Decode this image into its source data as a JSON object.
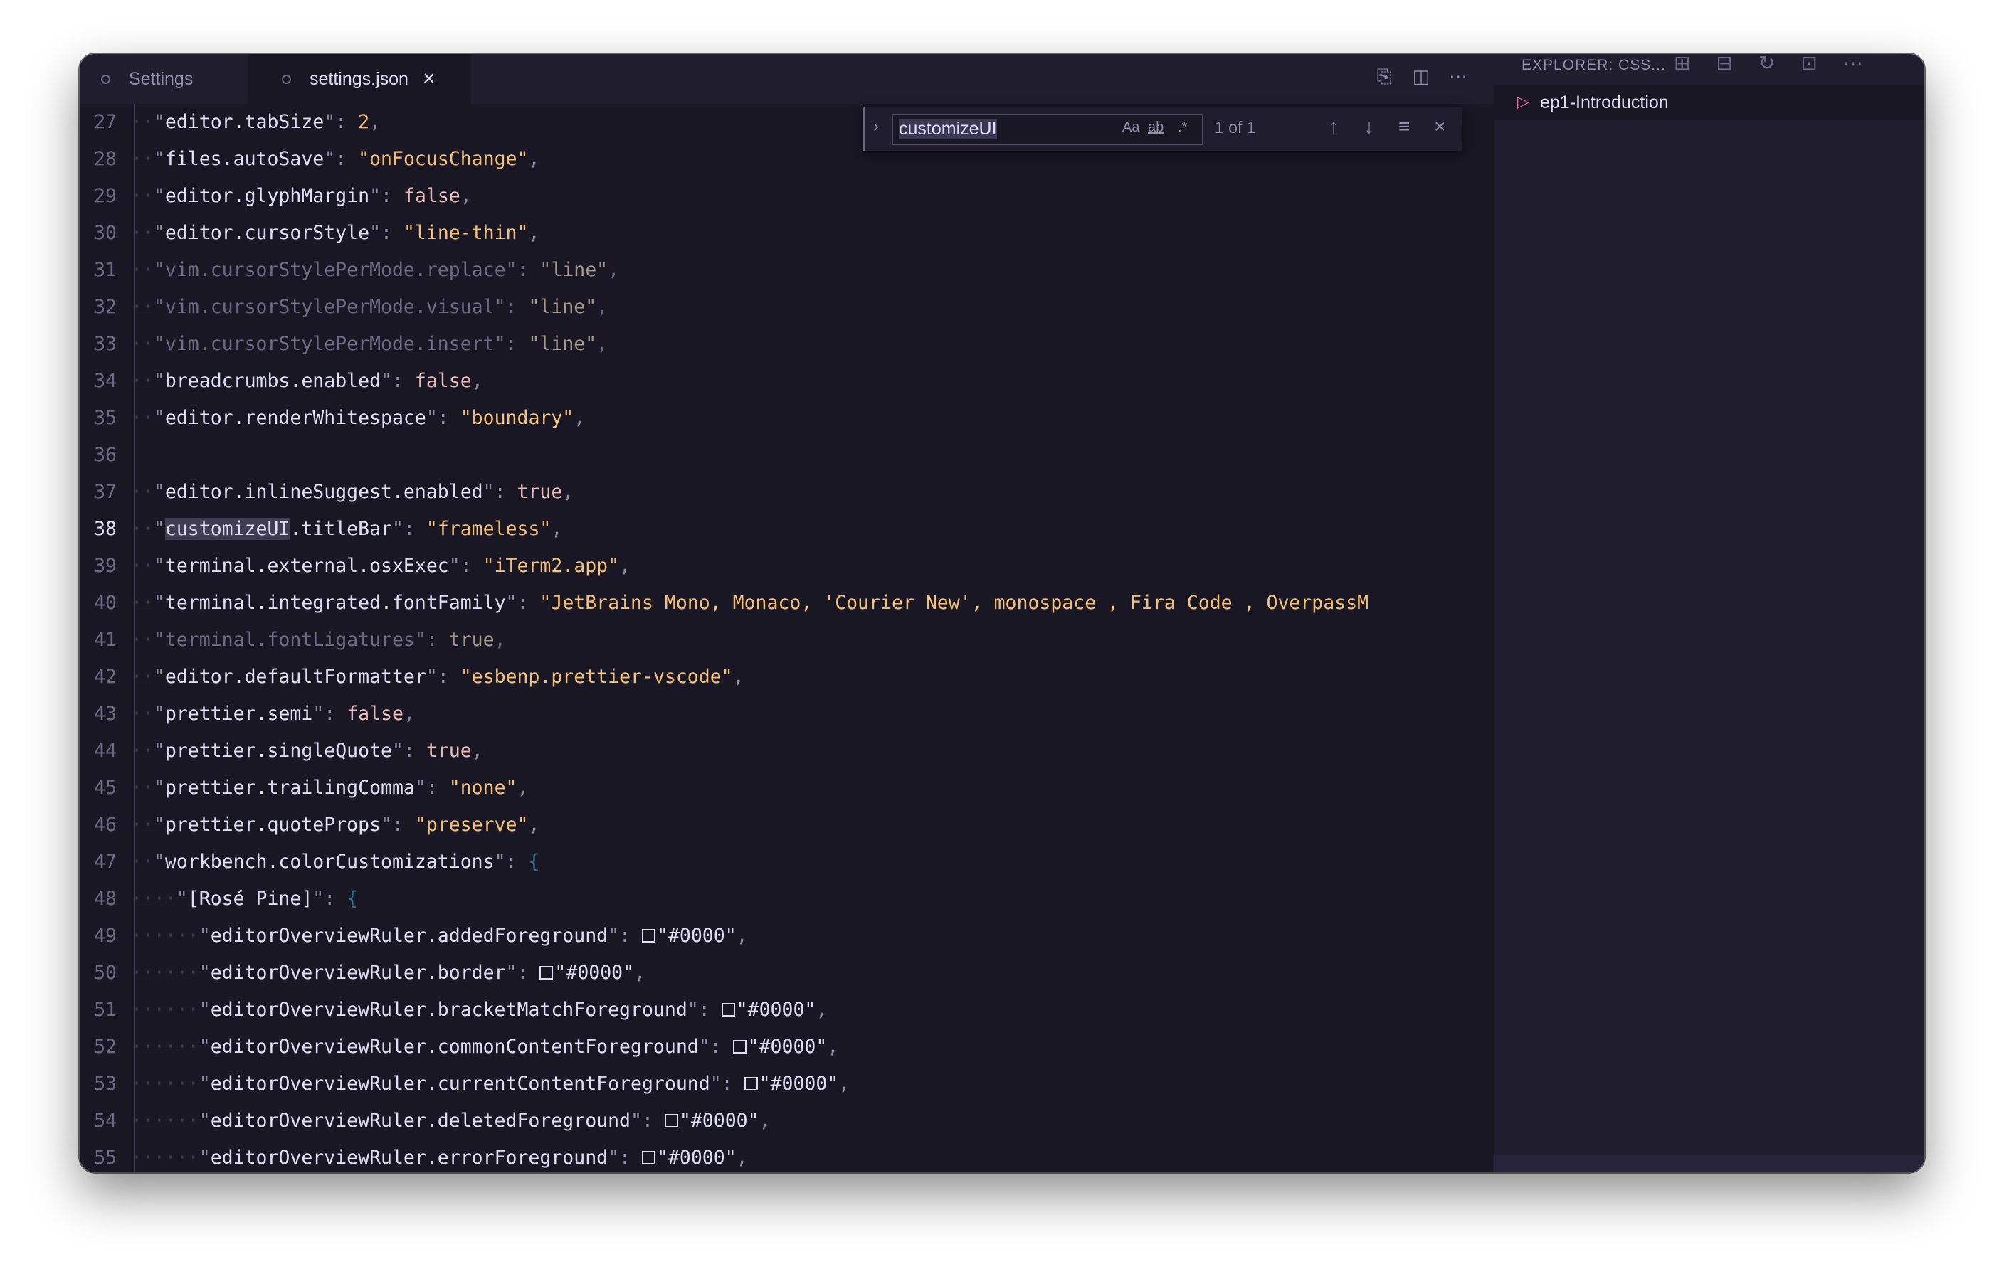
{
  "tabs": [
    {
      "label": "Settings",
      "active": false
    },
    {
      "label": "settings.json",
      "active": true
    }
  ],
  "tab_close_symbol": "×",
  "icons": {
    "open_preview": "open-file-icon",
    "split": "split-editor-icon",
    "more": "more-actions-icon"
  },
  "find": {
    "query": "customizeUI",
    "match_case": "Aa",
    "whole_word": "ab",
    "regex": ".*",
    "count": "1 of 1"
  },
  "explorer": {
    "title": "EXPLORER: CSS...",
    "items": [
      {
        "label": "ep1-Introduction"
      }
    ]
  },
  "editor": {
    "current_line": 38,
    "lines": [
      {
        "n": 27,
        "d": 1,
        "k": "editor.tabSize",
        "t": "num",
        "v": "2"
      },
      {
        "n": 28,
        "d": 1,
        "k": "files.autoSave",
        "t": "str",
        "v": "\"onFocusChange\""
      },
      {
        "n": 29,
        "d": 1,
        "k": "editor.glyphMargin",
        "t": "bool",
        "v": "false"
      },
      {
        "n": 30,
        "d": 1,
        "k": "editor.cursorStyle",
        "t": "str",
        "v": "\"line-thin\""
      },
      {
        "n": 31,
        "d": 1,
        "k": "vim.cursorStylePerMode.replace",
        "t": "str",
        "v": "\"line\"",
        "dim": true
      },
      {
        "n": 32,
        "d": 1,
        "k": "vim.cursorStylePerMode.visual",
        "t": "str",
        "v": "\"line\"",
        "dim": true
      },
      {
        "n": 33,
        "d": 1,
        "k": "vim.cursorStylePerMode.insert",
        "t": "str",
        "v": "\"line\"",
        "dim": true
      },
      {
        "n": 34,
        "d": 1,
        "k": "breadcrumbs.enabled",
        "t": "bool",
        "v": "false"
      },
      {
        "n": 35,
        "d": 1,
        "k": "editor.renderWhitespace",
        "t": "str",
        "v": "\"boundary\""
      },
      {
        "n": 36,
        "d": 0,
        "empty": true
      },
      {
        "n": 37,
        "d": 1,
        "k": "editor.inlineSuggest.enabled",
        "t": "bool",
        "v": "true"
      },
      {
        "n": 38,
        "d": 1,
        "k": "customizeUI.titleBar",
        "t": "str",
        "v": "\"frameless\"",
        "match": "customizeUI"
      },
      {
        "n": 39,
        "d": 1,
        "k": "terminal.external.osxExec",
        "t": "str",
        "v": "\"iTerm2.app\""
      },
      {
        "n": 40,
        "d": 1,
        "k": "terminal.integrated.fontFamily",
        "t": "str",
        "v": "\"JetBrains Mono, Monaco, 'Courier New', monospace , Fira Code , OverpassM",
        "nocomma": true
      },
      {
        "n": 41,
        "d": 1,
        "k": "terminal.fontLigatures",
        "t": "bool",
        "v": "true",
        "dim": true
      },
      {
        "n": 42,
        "d": 1,
        "k": "editor.defaultFormatter",
        "t": "str",
        "v": "\"esbenp.prettier-vscode\""
      },
      {
        "n": 43,
        "d": 1,
        "k": "prettier.semi",
        "t": "bool",
        "v": "false"
      },
      {
        "n": 44,
        "d": 1,
        "k": "prettier.singleQuote",
        "t": "bool",
        "v": "true"
      },
      {
        "n": 45,
        "d": 1,
        "k": "prettier.trailingComma",
        "t": "str",
        "v": "\"none\""
      },
      {
        "n": 46,
        "d": 1,
        "k": "prettier.quoteProps",
        "t": "str",
        "v": "\"preserve\""
      },
      {
        "n": 47,
        "d": 1,
        "k": "workbench.colorCustomizations",
        "t": "brace",
        "v": "{",
        "nocomma": true
      },
      {
        "n": 48,
        "d": 2,
        "k": "[Rosé Pine]",
        "t": "brace",
        "v": "{",
        "nocomma": true
      },
      {
        "n": 49,
        "d": 3,
        "k": "editorOverviewRuler.addedForeground",
        "t": "color",
        "v": "\"#0000\""
      },
      {
        "n": 50,
        "d": 3,
        "k": "editorOverviewRuler.border",
        "t": "color",
        "v": "\"#0000\""
      },
      {
        "n": 51,
        "d": 3,
        "k": "editorOverviewRuler.bracketMatchForeground",
        "t": "color",
        "v": "\"#0000\""
      },
      {
        "n": 52,
        "d": 3,
        "k": "editorOverviewRuler.commonContentForeground",
        "t": "color",
        "v": "\"#0000\""
      },
      {
        "n": 53,
        "d": 3,
        "k": "editorOverviewRuler.currentContentForeground",
        "t": "color",
        "v": "\"#0000\""
      },
      {
        "n": 54,
        "d": 3,
        "k": "editorOverviewRuler.deletedForeground",
        "t": "color",
        "v": "\"#0000\""
      },
      {
        "n": 55,
        "d": 3,
        "k": "editorOverviewRuler.errorForeground",
        "t": "color",
        "v": "\"#0000\""
      }
    ]
  },
  "theme": {
    "background": "#191724",
    "surface": "#1f1d2e",
    "text": "#e0def4",
    "muted": "#908caa",
    "gold": "#f6c177",
    "rose": "#ebbcba",
    "pine": "#31748f",
    "love": "#eb6f92"
  }
}
